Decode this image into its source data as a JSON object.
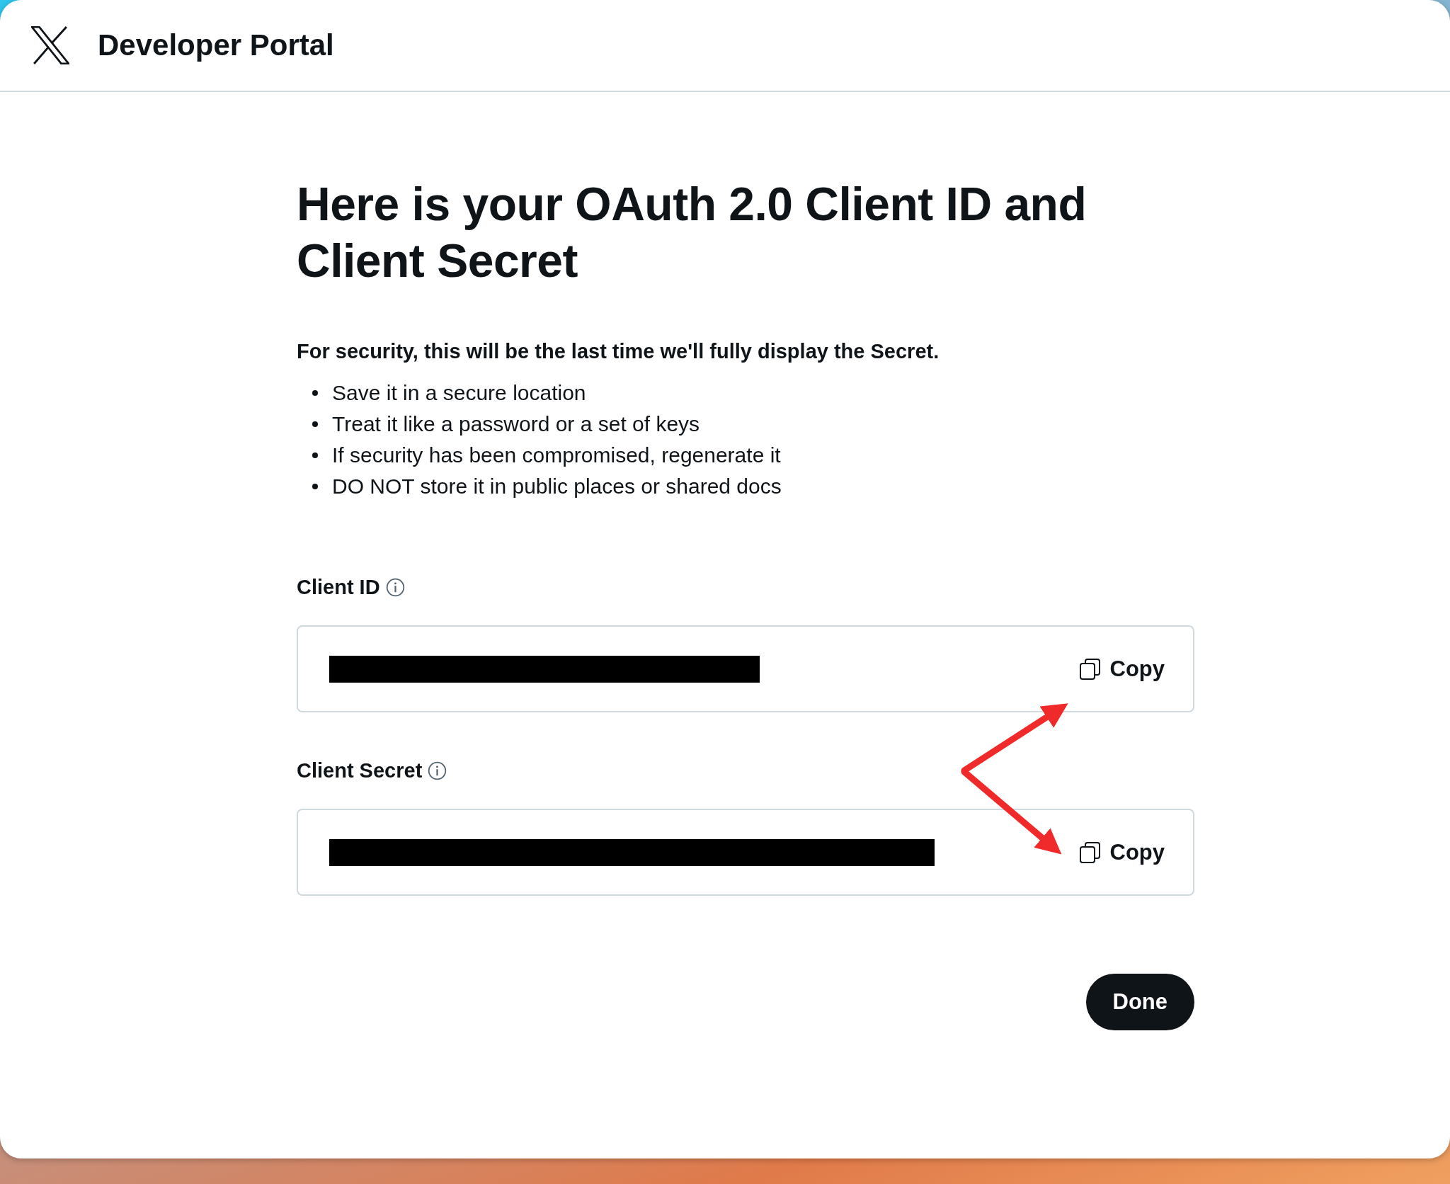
{
  "header": {
    "title": "Developer Portal"
  },
  "heading": "Here is your OAuth 2.0 Client ID and Client Secret",
  "notice": "For security, this will be the last time we'll fully display the Secret.",
  "tips": [
    "Save it in a secure location",
    "Treat it like a password or a set of keys",
    "If security has been compromised, regenerate it",
    "DO NOT store it in public places or shared docs"
  ],
  "credentials": [
    {
      "label": "Client ID",
      "redacted": true,
      "copy_label": "Copy"
    },
    {
      "label": "Client Secret",
      "redacted": true,
      "copy_label": "Copy"
    }
  ],
  "done_button": "Done"
}
